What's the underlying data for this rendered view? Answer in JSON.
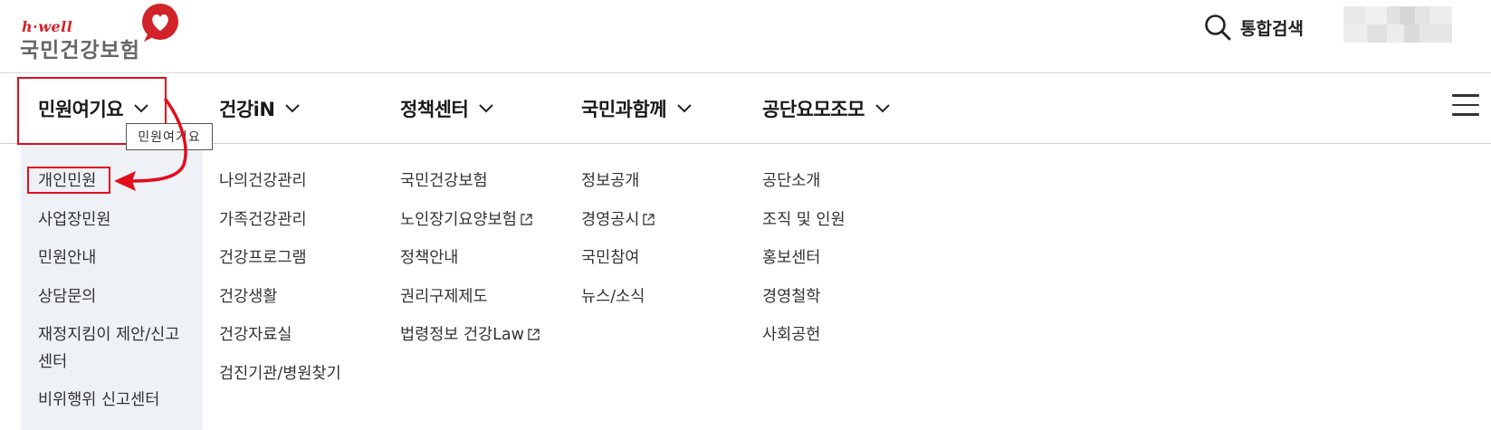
{
  "header": {
    "logo_sub": "h·well",
    "logo_main": "국민건강보험",
    "search_label": "통합검색"
  },
  "gnb": {
    "items": [
      {
        "label": "민원여기요"
      },
      {
        "label": "건강iN"
      },
      {
        "label": "정책센터"
      },
      {
        "label": "국민과함께"
      },
      {
        "label": "공단요모조모"
      }
    ],
    "tooltip": "민원여기요"
  },
  "submenu": {
    "col1": [
      "개인민원",
      "사업장민원",
      "민원안내",
      "상담문의",
      "재정지킴이 제안/신고센터",
      "비위행위 신고센터"
    ],
    "col2": [
      "나의건강관리",
      "가족건강관리",
      "건강프로그램",
      "건강생활",
      "건강자료실",
      "검진기관/병원찾기"
    ],
    "col3": [
      "국민건강보험",
      "노인장기요양보험",
      "정책안내",
      "권리구제제도",
      "법령정보 건강Law"
    ],
    "col4": [
      "정보공개",
      "경영공시",
      "국민참여",
      "뉴스/소식"
    ],
    "col5": [
      "공단소개",
      "조직 및 인원",
      "홍보센터",
      "경영철학",
      "사회공헌"
    ]
  },
  "colors": {
    "accent_red": "#e30d1b",
    "brand_red": "#d2232a",
    "dropdown_bg": "#eef1f6"
  },
  "icons": [
    "heart-logo-icon",
    "search-icon",
    "chevron-down-icon",
    "external-link-icon",
    "hamburger-menu-icon",
    "annotation-arrow"
  ]
}
